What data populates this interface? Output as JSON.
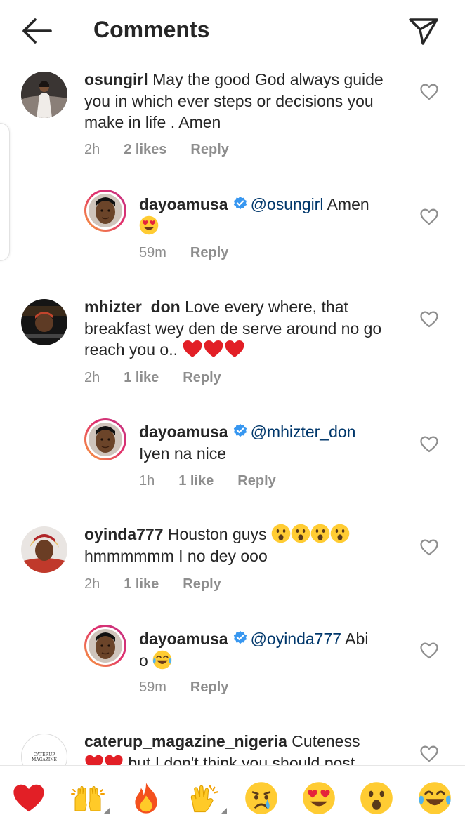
{
  "header": {
    "title": "Comments",
    "back_icon": "arrow-left-icon",
    "send_icon": "paper-plane-icon"
  },
  "colors": {
    "text": "#262626",
    "muted": "#8e8e8e",
    "mention": "#00376b",
    "verified": "#3897f0",
    "heart_red": "#ed1c24"
  },
  "comments": [
    {
      "username": "osungirl",
      "text": "May the good  God always guide you in which ever steps or decisions you make in life . Amen",
      "time": "2h",
      "likes": "2 likes",
      "reply_label": "Reply"
    },
    {
      "username": "dayoamusa",
      "mention": "@osungirl",
      "text": " Amen",
      "time": "59m",
      "reply_label": "Reply"
    },
    {
      "username": "mhizter_don",
      "text": "Love every where, that breakfast wey den de serve around no go reach you o..",
      "time": "2h",
      "likes": "1 like",
      "reply_label": "Reply"
    },
    {
      "username": "dayoamusa",
      "mention": "@mhizter_don",
      "text": "Iyen na nice",
      "time": "1h",
      "likes": "1 like",
      "reply_label": "Reply"
    },
    {
      "username": "oyinda777",
      "text": "Houston guys",
      "text2": "hmmmmmm I no dey ooo",
      "time": "2h",
      "likes": "1 like",
      "reply_label": "Reply"
    },
    {
      "username": "dayoamusa",
      "mention": "@oyinda777",
      "text": " Abi",
      "text2": "o",
      "time": "59m",
      "reply_label": "Reply"
    },
    {
      "username": "caterup_magazine_nigeria",
      "text": "Cuteness",
      "text2": "but I don't think you should post",
      "avatar_text": "CATERUP MAGAZINE"
    }
  ],
  "quick_reactions": [
    "red-heart",
    "raised-hands",
    "fire",
    "clapping-hands",
    "crying-face",
    "heart-eyes-face",
    "astonished-face",
    "tears-of-joy-face"
  ]
}
